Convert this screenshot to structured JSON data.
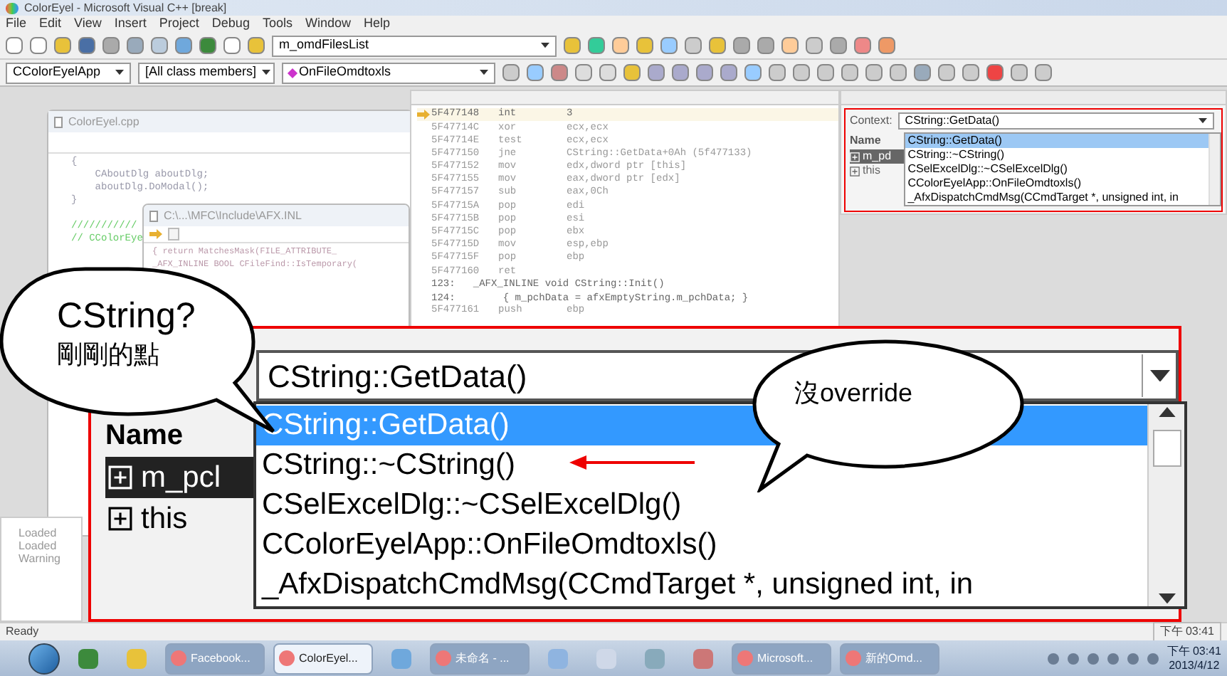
{
  "window": {
    "title": "ColorEyel - Microsoft Visual C++ [break]"
  },
  "menu": [
    "File",
    "Edit",
    "View",
    "Insert",
    "Project",
    "Debug",
    "Tools",
    "Window",
    "Help"
  ],
  "toolbar": {
    "workspace_combo": "m_omdFilesList"
  },
  "wizard_bar": {
    "class_combo": "CColorEyelApp",
    "members_combo": "[All class members]",
    "function_combo": "OnFileOmdtoxls"
  },
  "source_window": {
    "title": "ColorEyel.cpp",
    "lines": [
      "{",
      "    CAboutDlg aboutDlg;",
      "    aboutDlg.DoModal();",
      "}",
      "///////////",
      "// CColorEye"
    ]
  },
  "include_window": {
    "title": "C:\\...\\MFC\\Include\\AFX.INL",
    "lines": [
      "{ return MatchesMask(FILE_ATTRIBUTE_",
      "_AFX_INLINE BOOL CFileFind::IsTemporary("
    ]
  },
  "disassembly": {
    "rows": [
      {
        "kind": "asm",
        "address": "5F477148",
        "op": "int",
        "operand": "3",
        "current": true
      },
      {
        "kind": "asm",
        "address": "5F47714C",
        "op": "xor",
        "operand": "ecx,ecx",
        "current": false
      },
      {
        "kind": "asm",
        "address": "5F47714E",
        "op": "test",
        "operand": "ecx,ecx",
        "current": false
      },
      {
        "kind": "asm",
        "address": "5F477150",
        "op": "jne",
        "operand": "CString::GetData+0Ah (5f477133)",
        "current": false
      },
      {
        "kind": "asm",
        "address": "5F477152",
        "op": "mov",
        "operand": "edx,dword ptr [this]",
        "current": false
      },
      {
        "kind": "asm",
        "address": "5F477155",
        "op": "mov",
        "operand": "eax,dword ptr [edx]",
        "current": false
      },
      {
        "kind": "asm",
        "address": "5F477157",
        "op": "sub",
        "operand": "eax,0Ch",
        "current": false
      },
      {
        "kind": "asm",
        "address": "5F47715A",
        "op": "pop",
        "operand": "edi",
        "current": false
      },
      {
        "kind": "asm",
        "address": "5F47715B",
        "op": "pop",
        "operand": "esi",
        "current": false
      },
      {
        "kind": "asm",
        "address": "5F47715C",
        "op": "pop",
        "operand": "ebx",
        "current": false
      },
      {
        "kind": "asm",
        "address": "5F47715D",
        "op": "mov",
        "operand": "esp,ebp",
        "current": false
      },
      {
        "kind": "asm",
        "address": "5F47715F",
        "op": "pop",
        "operand": "ebp",
        "current": false
      },
      {
        "kind": "asm",
        "address": "5F477160",
        "op": "ret",
        "operand": "",
        "current": false
      },
      {
        "kind": "source",
        "text": "123:   _AFX_INLINE void CString::Init()"
      },
      {
        "kind": "source",
        "text": "124:        { m_pchData = afxEmptyString.m_pchData; }"
      },
      {
        "kind": "asm",
        "address": "5F477161",
        "op": "push",
        "operand": "ebp",
        "current": false
      }
    ]
  },
  "variables": {
    "context_label": "Context:",
    "context_value": "CString::GetData()",
    "name_header": "Name",
    "options": [
      {
        "label": "CString::GetData()",
        "selected": true
      },
      {
        "label": "CString::~CString()",
        "selected": false
      },
      {
        "label": "CSelExcelDlg::~CSelExcelDlg()",
        "selected": false
      },
      {
        "label": "CColorEyelApp::OnFileOmdtoxls()",
        "selected": false
      },
      {
        "label": "_AfxDispatchCmdMsg(CCmdTarget *, unsigned int, in",
        "selected": false
      }
    ],
    "rows": [
      {
        "label": "m_pd",
        "selected": true
      },
      {
        "label": "this",
        "selected": false
      }
    ]
  },
  "output": {
    "lines": [
      "Loaded",
      "Loaded",
      "Warning"
    ]
  },
  "magnified": {
    "context_value": "CString::GetData()",
    "name_header": "Name",
    "options": [
      {
        "label": "CString::GetData()",
        "selected": true
      },
      {
        "label": "CString::~CString()",
        "selected": false
      },
      {
        "label": "CSelExcelDlg::~CSelExcelDlg()",
        "selected": false
      },
      {
        "label": "CColorEyelApp::OnFileOmdtoxls()",
        "selected": false
      },
      {
        "label": "_AfxDispatchCmdMsg(CCmdTarget *, unsigned int, in",
        "selected": false
      }
    ],
    "rows": [
      {
        "label": "m_pcl",
        "selected": true
      },
      {
        "label": "this",
        "selected": false
      }
    ]
  },
  "callouts": [
    {
      "lines": [
        "CString?",
        "剛剛的點"
      ]
    },
    {
      "lines": [
        "沒override"
      ]
    }
  ],
  "status_bar": {
    "text": "Ready",
    "time": "下午 03:41"
  },
  "taskbar": {
    "items": [
      {
        "kind": "icon"
      },
      {
        "kind": "icon"
      },
      {
        "kind": "window",
        "label": "Facebook...",
        "active": false
      },
      {
        "kind": "window",
        "label": "ColorEyel...",
        "active": true
      },
      {
        "kind": "icon"
      },
      {
        "kind": "window",
        "label": "未命名 - ...",
        "active": false
      },
      {
        "kind": "icon"
      },
      {
        "kind": "icon"
      },
      {
        "kind": "icon"
      },
      {
        "kind": "icon"
      },
      {
        "kind": "window",
        "label": "Microsoft...",
        "active": false
      },
      {
        "kind": "window",
        "label": "新的Omd...",
        "active": false
      }
    ],
    "clock_time": "下午 03:41",
    "clock_date": "2013/4/12"
  }
}
